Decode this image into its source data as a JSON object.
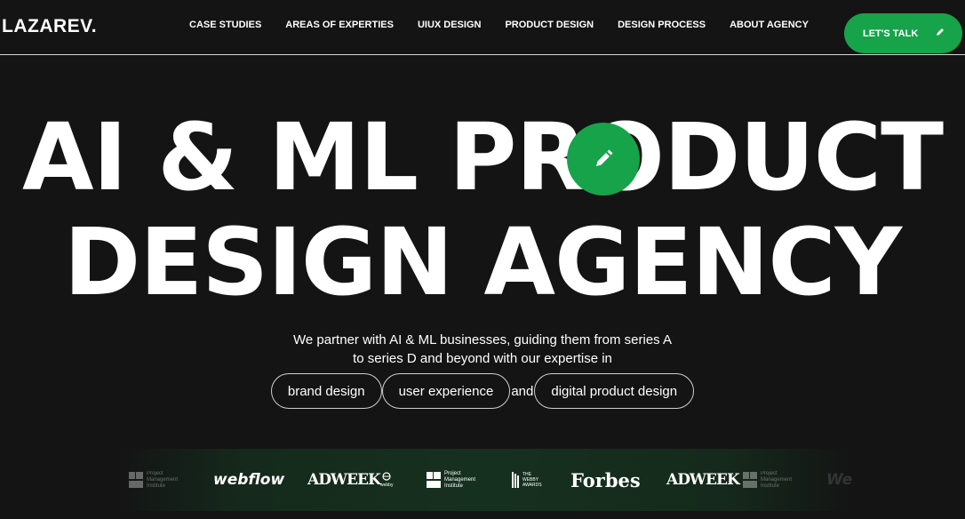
{
  "header": {
    "logo": "LAZAREV.",
    "nav": [
      "CASE STUDIES",
      "AREAS OF EXPERTIES",
      "UIUX DESIGN",
      "PRODUCT DESIGN",
      "DESIGN PROCESS",
      "ABOUT AGENCY"
    ],
    "cta_label": "LET'S TALK"
  },
  "hero": {
    "line1": "AI & ML PRODUCT",
    "line2": "DESIGN AGENCY",
    "subtitle_line1": "We partner with AI & ML businesses, guiding them from series A",
    "subtitle_line2": "to series D and beyond with our expertise in",
    "pills": [
      "brand design",
      "user experience",
      "digital product design"
    ],
    "connector": "and"
  },
  "logos": {
    "pmi_line1": "Project",
    "pmi_line2": "Management",
    "pmi_line3": "Institute",
    "webflow": "webflow",
    "adweek": "ADWEEK",
    "webbie_label": "webby",
    "webby_line1": "THE",
    "webby_line2": "WEBBY",
    "webby_line3": "AWARDS",
    "forbes": "Forbes",
    "faint_text": "We"
  },
  "colors": {
    "background": "#141414",
    "accent": "#16a34a",
    "text": "#ffffff"
  },
  "icons": {
    "cta": "pencil-icon",
    "hero_badge": "pencil-icon"
  }
}
